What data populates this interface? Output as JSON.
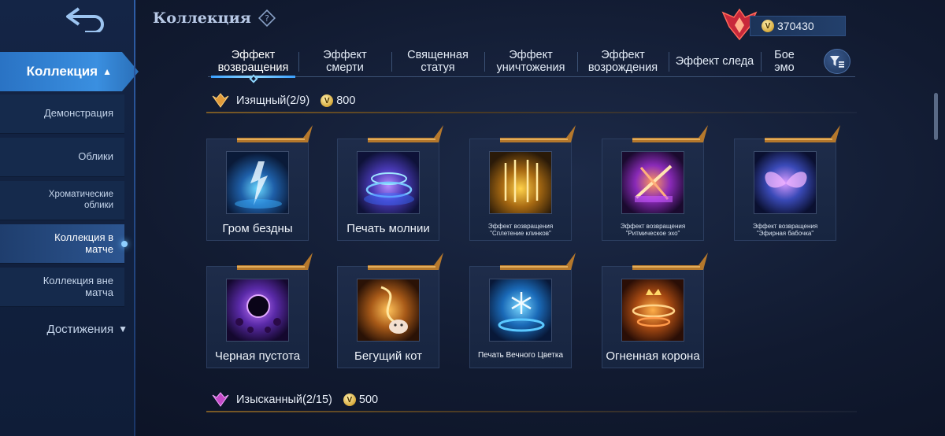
{
  "header": {
    "title": "Коллекция",
    "currency_value": "370430"
  },
  "sidebar": {
    "main_label": "Коллекция",
    "items": [
      {
        "label": "Демонстрация"
      },
      {
        "label": "Облики"
      },
      {
        "label": "Хроматические облики"
      },
      {
        "label": "Коллекция в матче"
      },
      {
        "label": "Коллекция вне матча"
      }
    ],
    "achievements_label": "Достижения"
  },
  "tabs": [
    {
      "label": "Эффект возвращения",
      "active": true
    },
    {
      "label": "Эффект смерти"
    },
    {
      "label": "Священная статуя"
    },
    {
      "label": "Эффект уничтожения"
    },
    {
      "label": "Эффект возрождения"
    },
    {
      "label": "Эффект следа"
    },
    {
      "label": "Бое эмо"
    }
  ],
  "sections": [
    {
      "title": "Изящный(2/9)",
      "cost": "800",
      "cards": [
        {
          "name": "Гром бездны"
        },
        {
          "name": "Печать молнии"
        },
        {
          "name": "Эффект возвращения \"Сплетение клинков\""
        },
        {
          "name": "Эффект возвращения \"Ритмическое эхо\""
        },
        {
          "name": "Эффект возвращения \"Эфирная бабочка\""
        },
        {
          "name": "Черная пустота"
        },
        {
          "name": "Бегущий кот"
        },
        {
          "name": "Печать Вечного Цветка"
        },
        {
          "name": "Огненная корона"
        }
      ]
    },
    {
      "title": "Изысканный(2/15)",
      "cost": "500"
    }
  ],
  "colors": {
    "accent": "#3a8fe0",
    "gold": "#d6a93a",
    "background": "#111a30"
  }
}
